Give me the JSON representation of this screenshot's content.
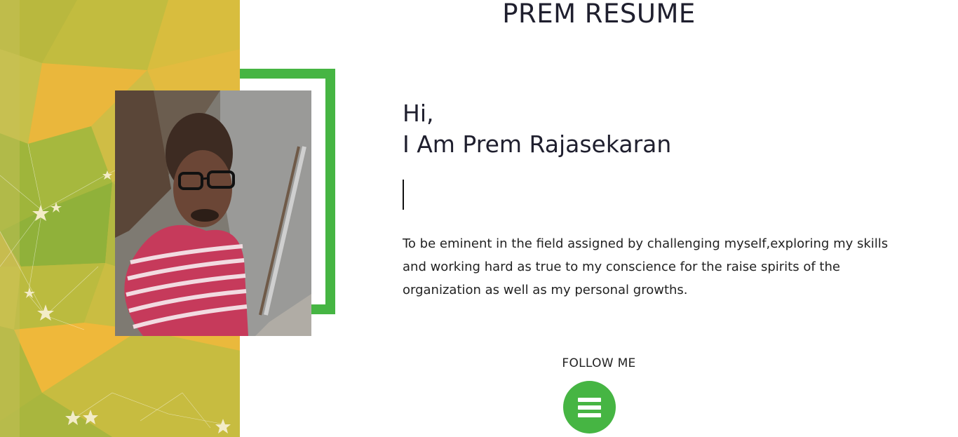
{
  "header": {
    "title": "PREM RESUME"
  },
  "hero": {
    "greeting_line1": "Hi,",
    "greeting_line2": "I Am Prem Rajasekaran",
    "objective": "To be eminent in the field assigned by challenging myself,exploring my skills and working hard as true to my conscience for the raise spirits of the organization as well as my personal growths."
  },
  "follow": {
    "label": "FOLLOW ME",
    "menu_icon": "hamburger-menu-icon"
  },
  "colors": {
    "accent_green": "#46b543",
    "panel_yellow": "#e9b93e",
    "panel_olive": "#b7b83c",
    "text_dark": "#1f1f2e"
  }
}
